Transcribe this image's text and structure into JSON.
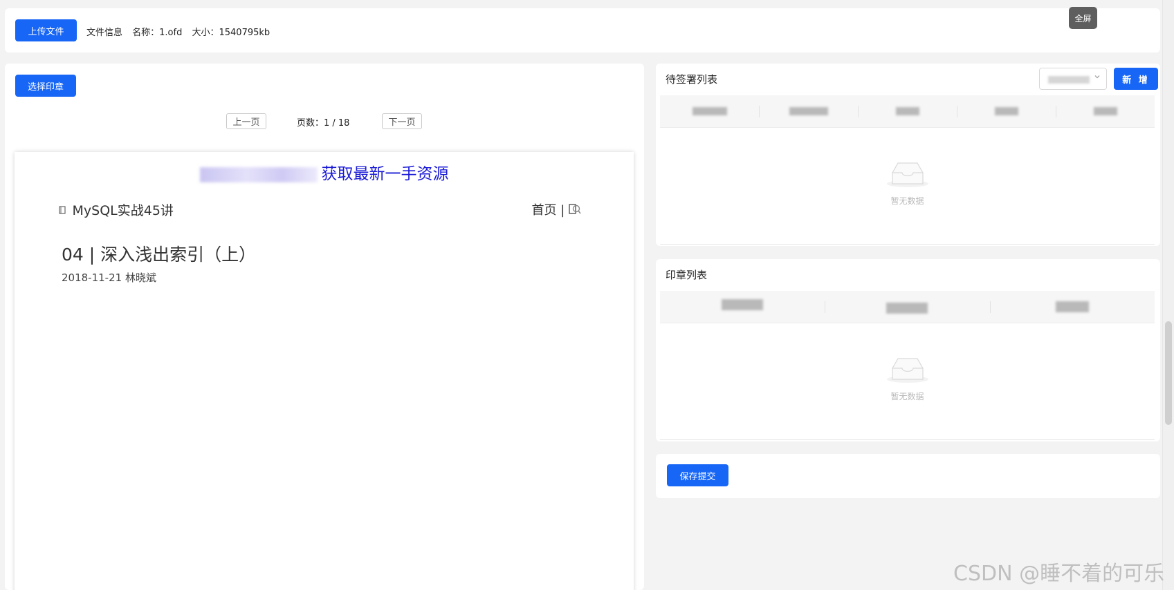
{
  "topbar": {
    "upload_label": "上传文件",
    "file_info_label": "文件信息",
    "file_name": "名称：1.ofd",
    "file_size": "大小：1540795kb"
  },
  "tooltip": {
    "fullscreen": "全屏"
  },
  "viewer": {
    "select_seal_label": "选择印章",
    "prev_label": "上一页",
    "next_label": "下一页",
    "page_count": "页数：1 / 18",
    "doc": {
      "banner_text": "获取最新一手资源",
      "course_title": "MySQL实战45讲",
      "nav_text": "首页 |",
      "article_title": "04 | 深入浅出索引（上）",
      "meta": "2018-11-21 林晓斌"
    }
  },
  "pending_list": {
    "title": "待签署列表",
    "add_label": "新 增",
    "empty_text": "暂无数据",
    "column_count": 5
  },
  "seal_list": {
    "title": "印章列表",
    "empty_text": "暂无数据",
    "column_count": 3
  },
  "submit": {
    "label": "保存提交"
  },
  "watermark": "CSDN @睡不着的可乐",
  "colors": {
    "primary": "#1766f5",
    "banner": "#1a1ad6",
    "background": "#f3f3f3"
  },
  "icons": [
    "book-icon",
    "search-icon",
    "empty-inbox-icon",
    "chevron-down-icon"
  ]
}
